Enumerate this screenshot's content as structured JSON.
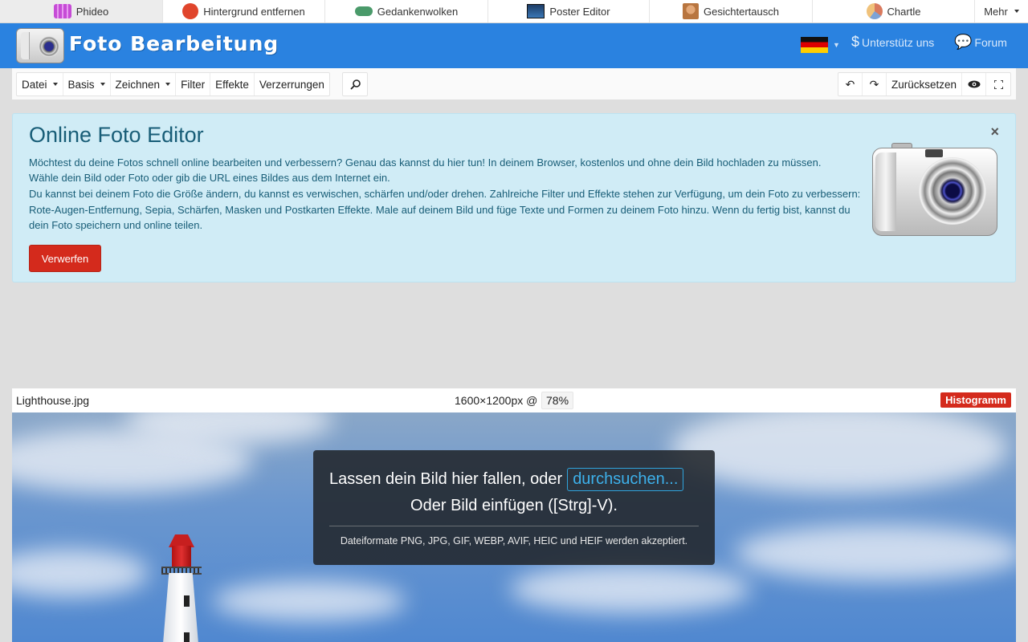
{
  "apps": [
    {
      "label": "Phideo",
      "icon": "film-icon",
      "color": "#c64bd6",
      "active": true
    },
    {
      "label": "Hintergrund entfernen",
      "icon": "background-remove-icon",
      "color": "#e0452c"
    },
    {
      "label": "Gedankenwolken",
      "icon": "mind-cloud-icon",
      "color": "#4a9a6a"
    },
    {
      "label": "Poster Editor",
      "icon": "poster-icon",
      "color": "#1d3d66"
    },
    {
      "label": "Gesichtertausch",
      "icon": "face-swap-icon",
      "color": "#b8753f"
    },
    {
      "label": "Chartle",
      "icon": "pie-chart-icon",
      "color": "#d97a5e"
    },
    {
      "label": "Mehr",
      "icon": "caret-down-icon"
    }
  ],
  "header": {
    "title": "Foto Bearbeitung",
    "language": "de",
    "support_label": "Unterstütz uns",
    "forum_label": "Forum",
    "brand_color": "#2a82e0"
  },
  "toolbar": {
    "menus": [
      "Datei",
      "Basis",
      "Zeichnen",
      "Filter",
      "Effekte",
      "Verzerrungen"
    ],
    "reset_label": "Zurücksetzen"
  },
  "alert": {
    "title": "Online Foto Editor",
    "line1": "Möchtest du deine Fotos schnell online bearbeiten und verbessern? Genau das kannst du hier tun! In deinem Browser, kostenlos und ohne dein Bild hochladen zu müssen.",
    "line2": "Wähle dein Bild oder Foto oder gib die URL eines Bildes aus dem Internet ein.",
    "line3": "Du kannst bei deinem Foto die Größe ändern, du kannst es verwischen, schärfen und/oder drehen. Zahlreiche Filter und Effekte stehen zur Verfügung, um dein Foto zu verbessern: Rote-Augen-Entfernung, Sepia, Schärfen, Masken und Postkarten Effekte. Male auf deinem Bild und füge Texte und Formen zu deinem Foto hinzu. Wenn du fertig bist, kannst du dein Foto speichern und online teilen.",
    "discard_label": "Verwerfen",
    "close_label": "×"
  },
  "image": {
    "filename": "Lighthouse.jpg",
    "dimensions": "1600×1200px @",
    "zoom": "78%",
    "histogram_label": "Histogramm"
  },
  "dropzone": {
    "text1": "Lassen dein Bild hier fallen, oder",
    "browse_label": "durchsuchen...",
    "text2": "Oder Bild einfügen ([Strg]-V).",
    "formats": "Dateiformate PNG, JPG, GIF, WEBP, AVIF, HEIC und HEIF werden akzeptiert."
  }
}
